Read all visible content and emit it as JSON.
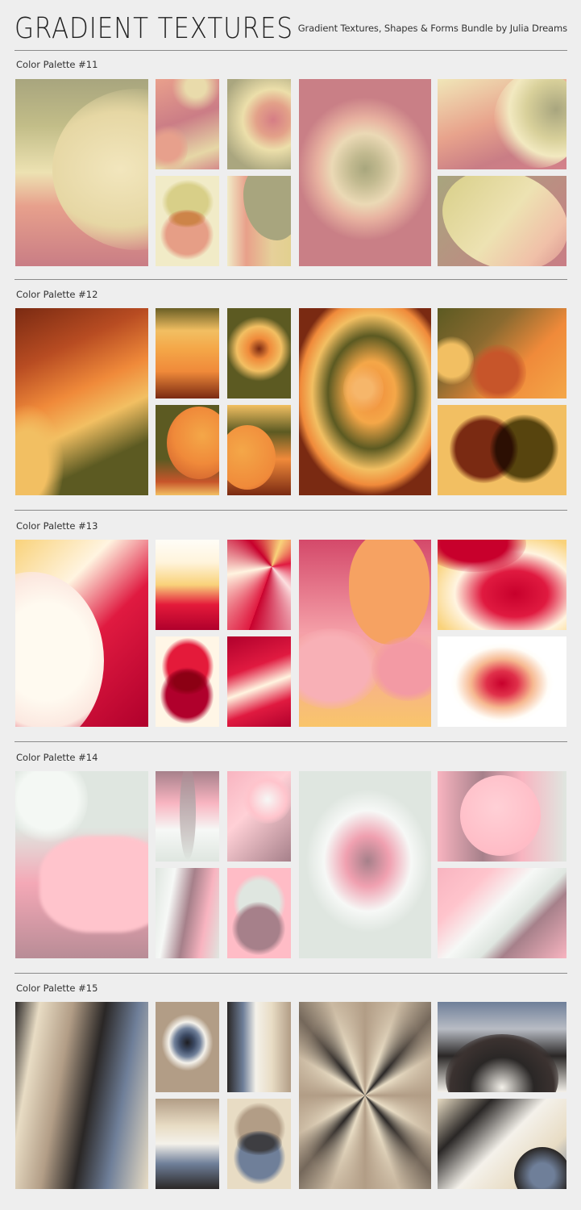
{
  "header": {
    "title": "GRADIENT TEXTURES",
    "subtitle": "Gradient Textures, Shapes & Forms Bundle by Julia Dreams"
  },
  "sections": [
    {
      "label": "Color Palette #11",
      "palette": [
        "#a8a57e",
        "#e8e0b0",
        "#e8a38c",
        "#c97d85",
        "#f2ecc8"
      ],
      "tiles": [
        "crescent-vertical-gradient",
        "abstract-blobs",
        "swirl",
        "radial-ring",
        "wave",
        "overlapping-circles",
        "curved-fold",
        "tilted-ellipse"
      ]
    },
    {
      "label": "Color Palette #12",
      "palette": [
        "#7a2a12",
        "#f08a3a",
        "#f2bf62",
        "#5c5a22",
        "#c7552a"
      ],
      "tiles": [
        "diagonal-sweep",
        "horizontal-bands",
        "radial-ring",
        "swirl",
        "circle-fold",
        "sphere",
        "blobs",
        "overlapping-circles"
      ]
    },
    {
      "label": "Color Palette #13",
      "palette": [
        "#f9d27a",
        "#fffaf0",
        "#c8002c",
        "#e03060",
        "#f6a0a8",
        "#f6a262"
      ],
      "tiles": [
        "crescent",
        "horizontal-bands",
        "conic-burst",
        "overlapping-circles",
        "wave",
        "blobs",
        "swirl",
        "radial-dot"
      ]
    },
    {
      "label": "Color Palette #14",
      "palette": [
        "#dfe6e0",
        "#f6f8f6",
        "#f8b4c0",
        "#a6808a",
        "#ffc4cc"
      ],
      "tiles": [
        "blob-curves",
        "vertical-ribbon",
        "swirl",
        "fold",
        "overlapping-circles",
        "radial-ring",
        "sphere",
        "diagonal-beam"
      ]
    },
    {
      "label": "Color Palette #15",
      "palette": [
        "#2a2726",
        "#b29d86",
        "#e8dcc4",
        "#6f7f99",
        "#f4f1ea"
      ],
      "tiles": [
        "flowing-stripes",
        "radial-ring",
        "fold",
        "horizontal-bands",
        "overlapping-circles",
        "conic-flower",
        "arch",
        "wave"
      ]
    }
  ]
}
